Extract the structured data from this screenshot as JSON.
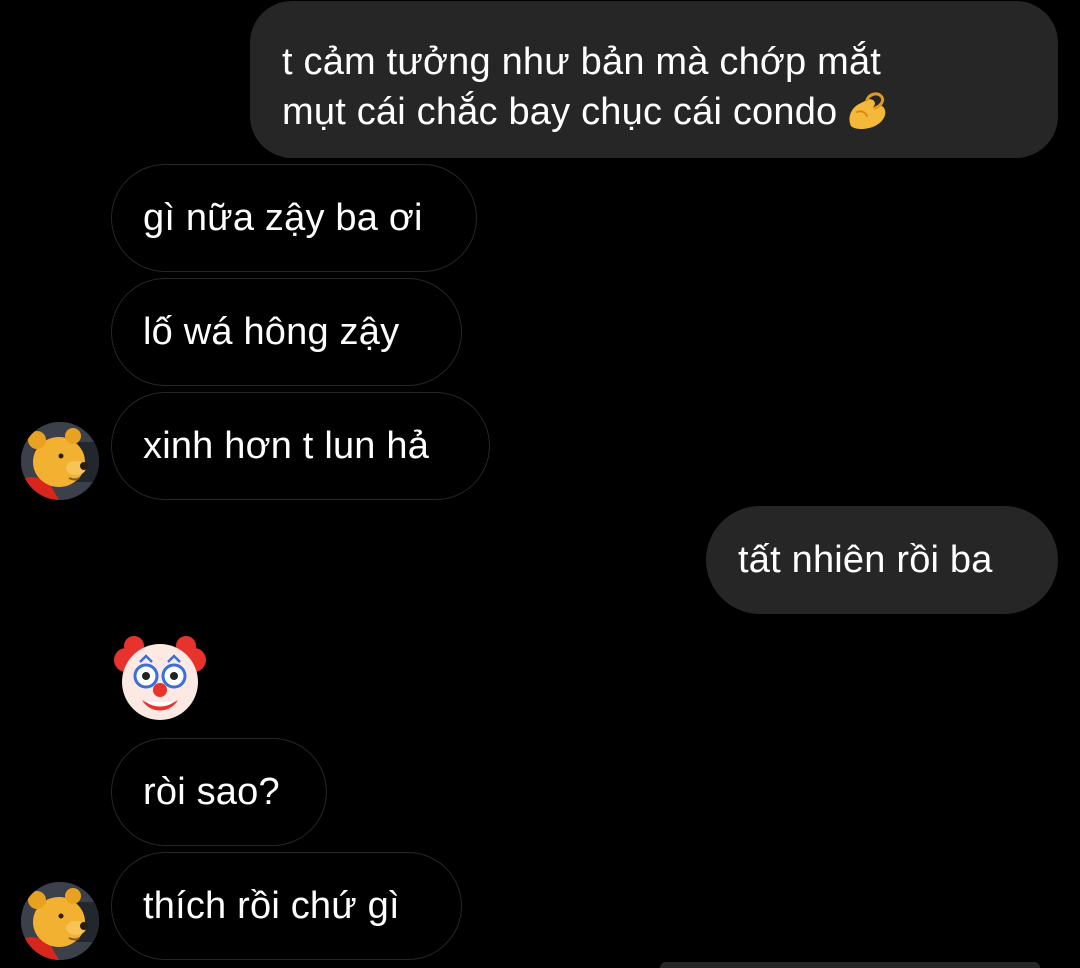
{
  "conversation": {
    "messages": [
      {
        "direction": "sent",
        "lines": [
          "t cảm tưởng như bản mà chớp mắt",
          "mụt cái chắc bay chục cái condo"
        ],
        "trailing_emoji": "pinching-hand"
      },
      {
        "direction": "received",
        "text": "gì nữa zậy ba ơi"
      },
      {
        "direction": "received",
        "text": "lố wá hông zậy"
      },
      {
        "direction": "received",
        "text": "xinh hơn t lun hả",
        "avatar": "winnie-the-pooh"
      },
      {
        "direction": "sent",
        "text": "tất nhiên rồi ba"
      },
      {
        "direction": "received",
        "emoji": "clown-face"
      },
      {
        "direction": "received",
        "text": "ròi sao?"
      },
      {
        "direction": "received",
        "text": "thích rồi chứ gì",
        "avatar": "winnie-the-pooh"
      }
    ]
  },
  "colors": {
    "background": "#000000",
    "sent_bubble": "#262626",
    "received_border": "#262626",
    "text": "#ffffff"
  }
}
